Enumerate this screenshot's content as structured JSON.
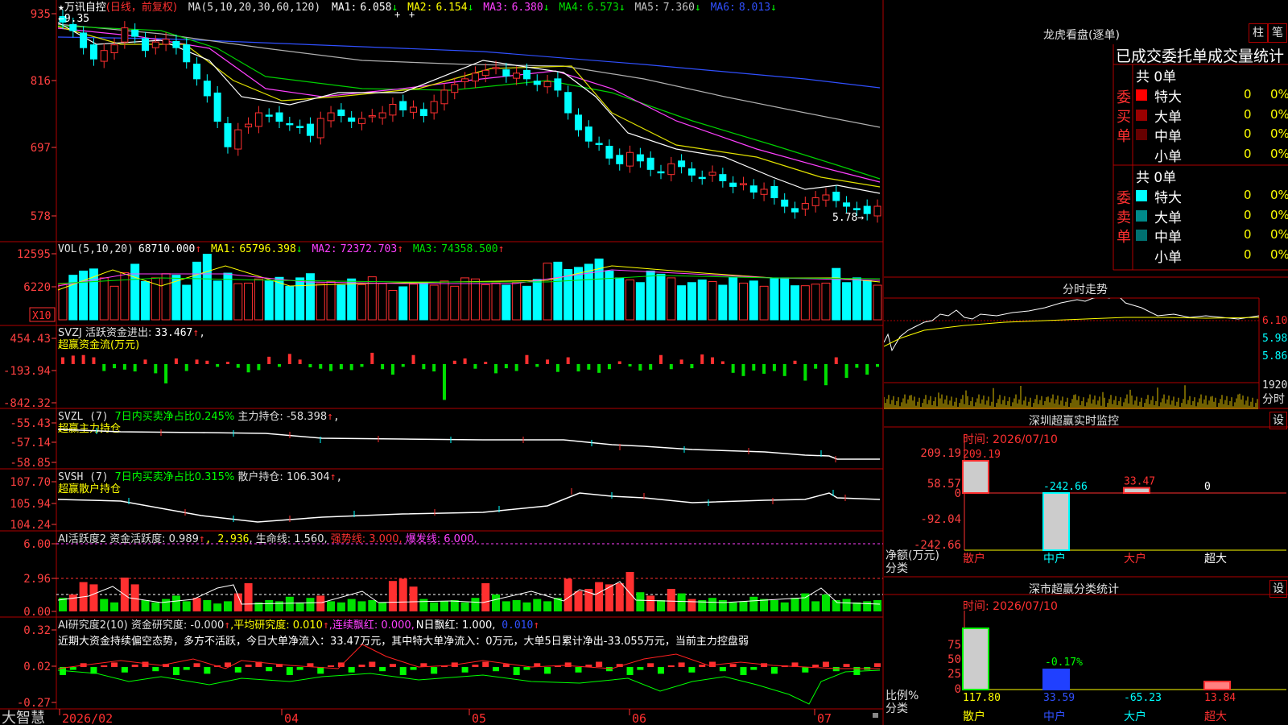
{
  "main_panel": {
    "name_prefix": "★",
    "stock_name": "万讯自控",
    "period": "(日线，前复权)",
    "ma_label": "MA(5,10,20,30,60,120)",
    "ma_values": [
      {
        "label": "MA1:",
        "value": "6.058",
        "arrow": "↓",
        "color": "#ffffff"
      },
      {
        "label": "MA2:",
        "value": "6.154",
        "arrow": "↓",
        "color": "#ffff00"
      },
      {
        "label": "MA3:",
        "value": "6.380",
        "arrow": "↓",
        "color": "#ff40ff"
      },
      {
        "label": "MA4:",
        "value": "6.573",
        "arrow": "↓",
        "color": "#00e000"
      },
      {
        "label": "MA5:",
        "value": "7.360",
        "arrow": "↓",
        "color": "#c0c0c0"
      },
      {
        "label": "MA6:",
        "value": "8.013",
        "arrow": "↓",
        "color": "#3050ff"
      }
    ],
    "high_marker": "9.35",
    "low_marker": "5.78→",
    "yticks": [
      "935",
      "816",
      "697",
      "578"
    ]
  },
  "vol_panel": {
    "label": "VOL(5,10,20)",
    "value": "68710.000",
    "arrow": "↑",
    "ma_values": [
      {
        "label": "MA1:",
        "value": "65796.398",
        "arrow": "↓",
        "color": "#ffff00"
      },
      {
        "label": "MA2:",
        "value": "72372.703",
        "arrow": "↑",
        "color": "#ff40ff"
      },
      {
        "label": "MA3:",
        "value": "74358.500",
        "arrow": "↑",
        "color": "#00e000"
      }
    ],
    "yticks": [
      "12595",
      "6220"
    ],
    "unit_box": "X10"
  },
  "svzj_panel": {
    "line1_label": "SVZJ  活跃资金进出:",
    "line1_value": "33.467",
    "arrow": "↑",
    "line1_suffix": ",",
    "line2": "超赢资金流(万元)",
    "yticks": [
      "454.43",
      "-193.94",
      "-842.32"
    ]
  },
  "svzl_panel": {
    "label": "SVZL (7) ",
    "ratio": "7日内买卖净占比0.245%",
    "text": " 主力持仓: -58.398",
    "arrow": "↑",
    "suffix": ",",
    "line2": "超赢主力持仓",
    "yticks": [
      "-55.43",
      "-57.14",
      "-58.85"
    ]
  },
  "svsh_panel": {
    "label": "SVSH (7) ",
    "ratio": "7日内买卖净占比0.315%",
    "text": " 散户持仓: 106.304",
    "arrow": "↑",
    "suffix": ",",
    "line2": "超赢散户持仓",
    "yticks": [
      "107.70",
      "105.94",
      "104.24"
    ]
  },
  "ai_activity_panel": {
    "label": "AI活跃度2 资金活跃度: 0.989",
    "arrow1": "↑",
    "v2": ", 2.936",
    "v3": ", 生命线: 1.560,",
    "strong": " 强势线: 3.000,",
    "burst": " 爆发线: 6.000,",
    "yticks": [
      "6.00",
      "2.96",
      "0.00"
    ]
  },
  "ai_research_panel": {
    "label": "AI研究度2(10) 资金研究度: -0.000",
    "arrow1": "↑",
    "avg": ",平均研究度: 0.010",
    "arrow2": "↑",
    "cont": ",连续飘红: 0.000,",
    "nred": "N日飘红: 1.000,",
    "last": " 0.010",
    "arrow3": "↑",
    "comment": "近期大资金持续偏空态势，多方不活跃，今日大单净流入：33.47万元，其中特大单净流入：0万元，大单5日累计净出-33.055万元，当前主力控盘弱",
    "yticks": [
      "0.32",
      "0.02",
      "-0.27"
    ]
  },
  "x_axis": {
    "brand": "大智慧",
    "labels": [
      "2026/02",
      "04",
      "05",
      "06",
      "07"
    ]
  },
  "dragon_tiger": {
    "title": "龙虎看盘(逐单)",
    "btn1": "柱",
    "btn2": "笔",
    "subtitle": "已成交委托单成交量统计",
    "buy": {
      "side_label": "委买单",
      "total": "共 0单",
      "rows": [
        {
          "name": "特大",
          "qty": "0",
          "pct": "0%",
          "color": "#ff0000"
        },
        {
          "name": "大单",
          "qty": "0",
          "pct": "0%",
          "color": "#990000"
        },
        {
          "name": "中单",
          "qty": "0",
          "pct": "0%",
          "color": "#660000"
        },
        {
          "name": "小单",
          "qty": "0",
          "pct": "0%",
          "color": "#000000"
        }
      ]
    },
    "sell": {
      "side_label": "委卖单",
      "total": "共 0单",
      "rows": [
        {
          "name": "特大",
          "qty": "0",
          "pct": "0%",
          "color": "#00ffff"
        },
        {
          "name": "大单",
          "qty": "0",
          "pct": "0%",
          "color": "#008a8a"
        },
        {
          "name": "中单",
          "qty": "0",
          "pct": "0%",
          "color": "#007070"
        },
        {
          "name": "小单",
          "qty": "0",
          "pct": "0%",
          "color": "#000000"
        }
      ]
    }
  },
  "intraday": {
    "title": "分时走势",
    "yticks": [
      "6.10",
      "5.98",
      "5.86"
    ],
    "vol_tick": "1920",
    "vol_label": "分时"
  },
  "sz_monitor": {
    "title": "深圳超赢实时监控",
    "set": "设",
    "time_label": "时间: 2026/07/10",
    "yticks": [
      "209.19",
      "58.57",
      "0",
      "-92.04",
      "-242.66"
    ],
    "y_label_1": "净额(万元)",
    "y_label_2": "分类",
    "values": [
      "209.19",
      "-242.66",
      "33.47",
      "0"
    ],
    "categories": [
      "散户",
      "中户",
      "大户",
      "超大"
    ]
  },
  "sz_class": {
    "title": "深市超赢分类统计",
    "set": "设",
    "time_label": "时间: 2026/07/10",
    "yticks": [
      "75",
      "50",
      "25",
      "0"
    ],
    "y_label_1": "比例%",
    "y_label_2": "分类",
    "top_label": "-0.17%",
    "values": [
      "117.80",
      "33.59",
      "-65.23",
      "13.84"
    ],
    "categories": [
      "散户",
      "中户",
      "大户",
      "超大"
    ]
  },
  "chart_data": [
    {
      "type": "candlestick",
      "title": "万讯自控 (日线，前复权)",
      "ylim": [
        5.78,
        9.35
      ],
      "yticks": [
        9.35,
        8.16,
        6.97,
        5.78
      ],
      "x_labels": [
        "2026/02",
        "04",
        "05",
        "06",
        "07"
      ],
      "close": [
        9.2,
        9.05,
        8.75,
        8.55,
        8.7,
        8.8,
        9.1,
        8.95,
        8.7,
        8.85,
        8.9,
        8.75,
        8.5,
        8.2,
        7.9,
        7.45,
        7.0,
        7.3,
        7.4,
        7.6,
        7.55,
        7.45,
        7.4,
        7.35,
        7.2,
        7.5,
        7.6,
        7.55,
        7.45,
        7.5,
        7.55,
        7.6,
        7.75,
        7.65,
        7.7,
        7.55,
        7.8,
        8.0,
        8.1,
        8.2,
        8.3,
        8.35,
        8.4,
        8.25,
        8.3,
        8.2,
        8.1,
        8.15,
        8.0,
        7.6,
        7.3,
        7.1,
        7.05,
        6.8,
        6.7,
        6.9,
        6.75,
        6.6,
        6.55,
        6.7,
        6.65,
        6.5,
        6.45,
        6.55,
        6.4,
        6.3,
        6.35,
        6.2,
        6.25,
        6.1,
        5.95,
        5.85,
        6.0,
        6.1,
        6.15,
        6.05,
        5.95,
        5.9,
        5.82,
        5.95
      ]
    },
    {
      "type": "bar",
      "title": "VOL(5,10,20)",
      "ylim": [
        0,
        12595
      ],
      "values": [
        6800,
        8500,
        9300,
        9700,
        8000,
        6400,
        9000,
        10600,
        7300,
        8000,
        8800,
        8500,
        6600,
        11000,
        12500,
        7400,
        8900,
        6900,
        7000,
        7800,
        7400,
        8100,
        6400,
        8000,
        8800,
        6900,
        7300,
        6600,
        7800,
        6700,
        8200,
        6900,
        5600,
        6300,
        6800,
        7000,
        6600,
        7400,
        6400,
        8000,
        7800,
        6700,
        7000,
        6600,
        7100,
        6400,
        7700,
        10800,
        11000,
        9600,
        10000,
        10600,
        11600,
        9300,
        8000,
        7600,
        7100,
        9300,
        8700,
        8000,
        6500,
        7100,
        7600,
        7300,
        6600,
        8100,
        7000,
        7400,
        6400,
        8000,
        8000,
        6500,
        6500,
        6800,
        7000,
        9800,
        7100,
        8000,
        7500,
        6600
      ]
    },
    {
      "type": "bar",
      "title": "超赢资金流(万元)",
      "ylim": [
        -842.32,
        454.43
      ],
      "values": [
        120,
        150,
        160,
        120,
        -150,
        -90,
        -120,
        -160,
        80,
        -200,
        -420,
        100,
        -150,
        80,
        60,
        -60,
        40,
        -80,
        -180,
        -130,
        130,
        -60,
        180,
        80,
        -70,
        -100,
        -150,
        -110,
        -130,
        -60,
        200,
        -110,
        -230,
        -60,
        160,
        -110,
        -160,
        -780,
        60,
        100,
        -100,
        40,
        -200,
        -90,
        -150,
        160,
        -60,
        80,
        -170,
        120,
        -160,
        -120,
        -190,
        -110,
        50,
        -50,
        -140,
        -120,
        160,
        -110,
        80,
        -90,
        170,
        120,
        50,
        -190,
        -260,
        -140,
        -210,
        -150,
        -260,
        60,
        -360,
        -100,
        -460,
        120,
        -300,
        -80,
        -230,
        -60
      ]
    },
    {
      "type": "line",
      "title": "超赢主力持仓",
      "ylim": [
        -58.85,
        -55.43
      ]
    },
    {
      "type": "line",
      "title": "超赢散户持仓",
      "ylim": [
        104.24,
        107.7
      ]
    },
    {
      "type": "bar",
      "title": "AI活跃度2",
      "ylim": [
        0,
        6.0
      ],
      "values": [
        1.2,
        1.5,
        2.6,
        2.4,
        1.1,
        0.8,
        3.0,
        2.4,
        1.0,
        0.8,
        1.1,
        1.4,
        0.9,
        1.2,
        1.0,
        0.7,
        0.9,
        1.6,
        2.5,
        0.8,
        1.0,
        0.9,
        1.3,
        0.8,
        1.2,
        1.4,
        0.9,
        0.8,
        1.1,
        0.9,
        1.0,
        0.8,
        2.7,
        2.9,
        2.2,
        1.1,
        0.8,
        0.9,
        1.0,
        0.8,
        1.2,
        2.5,
        1.5,
        0.9,
        1.0,
        0.8,
        1.1,
        0.9,
        1.2,
        2.9,
        1.8,
        2.0,
        2.6,
        2.4,
        2.5,
        3.5,
        1.7,
        1.4,
        1.0,
        2.0,
        1.6,
        1.1,
        1.0,
        1.2,
        1.0,
        0.8,
        0.9,
        1.3,
        1.1,
        1.0,
        0.8,
        1.2,
        1.6,
        0.9,
        1.5,
        1.0,
        1.1,
        0.8,
        0.9,
        1.0
      ]
    },
    {
      "type": "bar",
      "title": "AI研究度2(10)",
      "ylim": [
        -0.27,
        0.32
      ]
    },
    {
      "type": "line",
      "title": "分时走势",
      "ylim": [
        5.8,
        6.14
      ],
      "yticks": [
        6.1,
        5.98,
        5.86
      ]
    },
    {
      "type": "bar",
      "title": "深圳超赢实时监控",
      "categories": [
        "散户",
        "中户",
        "大户",
        "超大"
      ],
      "values": [
        209.19,
        -242.66,
        33.47,
        0
      ],
      "ylim": [
        -242.66,
        209.19
      ]
    },
    {
      "type": "bar",
      "title": "深市超赢分类统计",
      "categories": [
        "散户",
        "中户",
        "大户",
        "超大"
      ],
      "values": [
        117.8,
        33.59,
        -65.23,
        13.84
      ],
      "ylim": [
        0,
        75
      ]
    }
  ]
}
